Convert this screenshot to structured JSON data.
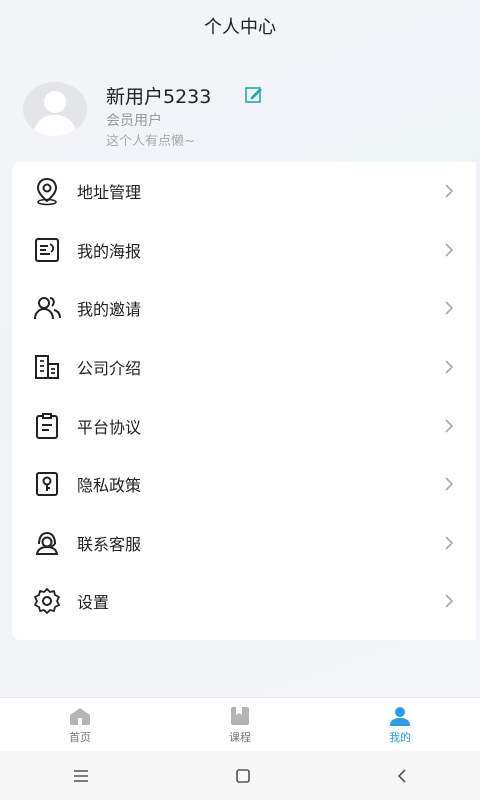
{
  "header": {
    "title": "个人中心"
  },
  "profile": {
    "username": "新用户5233",
    "member_type": "会员用户",
    "motto": "这个人有点懒~"
  },
  "menu": {
    "items": [
      {
        "label": "地址管理",
        "icon": "location-pin-icon"
      },
      {
        "label": "我的海报",
        "icon": "poster-icon"
      },
      {
        "label": "我的邀请",
        "icon": "invite-users-icon"
      },
      {
        "label": "公司介绍",
        "icon": "building-icon"
      },
      {
        "label": "平台协议",
        "icon": "clipboard-icon"
      },
      {
        "label": "隐私政策",
        "icon": "key-lock-icon"
      },
      {
        "label": "联系客服",
        "icon": "customer-service-icon"
      },
      {
        "label": "设置",
        "icon": "gear-icon"
      }
    ]
  },
  "tabbar": {
    "tabs": [
      {
        "label": "首页",
        "icon": "home-icon",
        "active": false
      },
      {
        "label": "课程",
        "icon": "course-icon",
        "active": false
      },
      {
        "label": "我的",
        "icon": "user-icon",
        "active": true
      }
    ],
    "active_color": "#2a9be5"
  }
}
